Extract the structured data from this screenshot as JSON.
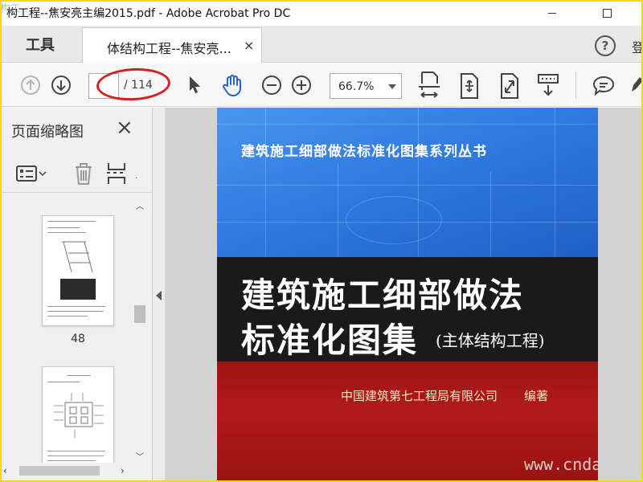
{
  "window": {
    "title": "构工程--焦安亮主编2015.pdf - Adobe Acrobat Pro DC",
    "watermark": "构工…"
  },
  "tabs": {
    "tools_label": "工具",
    "doc_tab_label": "体结构工程--焦安亮...",
    "doc_tab_close": "×",
    "help_label": "?",
    "signin_partial": "登"
  },
  "toolbar": {
    "current_page": "",
    "total_pages": "/ 114",
    "zoom": "66.7%"
  },
  "left_pane": {
    "title": "页面缩略图",
    "close": "×",
    "thumbnails": [
      {
        "page_number": "48"
      },
      {
        "page_number": ""
      }
    ]
  },
  "cover": {
    "series": "建筑施工细部做法标准化图集系列丛书",
    "title_line1": "建筑施工细部做法",
    "title_line2": "标准化图集",
    "subtitle": "(主体结构工程)",
    "publisher": "中国建筑第七工程局有限公司",
    "editor_role": "编著",
    "watermark": "www.cndac"
  },
  "colors": {
    "window_border": "#f2d91a",
    "accent_blue": "#2266cc",
    "annotation_red": "#d62020",
    "cover_blue": "#2f7be0",
    "cover_black": "#1a1a1a",
    "cover_red": "#b11a1a"
  }
}
